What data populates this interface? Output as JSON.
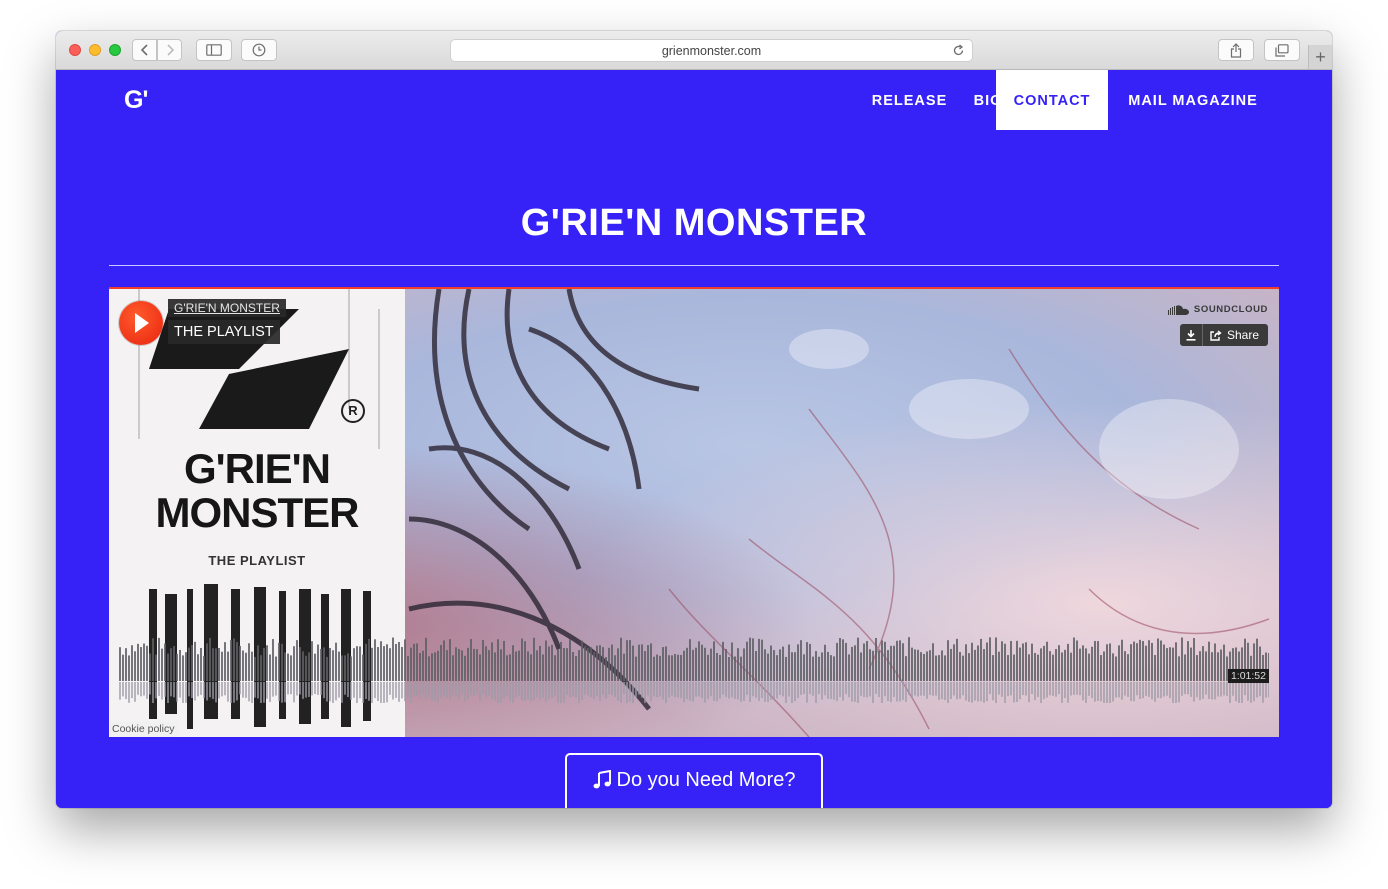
{
  "browser": {
    "url": "grienmonster.com"
  },
  "site": {
    "logo": "G'",
    "nav": [
      {
        "label": "RELEASE"
      },
      {
        "label": "BIO"
      },
      {
        "label": "CONTACT",
        "active": true
      },
      {
        "label": "MAIL MAGAZINE"
      }
    ],
    "title": "G'RIE'N MONSTER",
    "accent_color": "#3622f7"
  },
  "player": {
    "artist": "G'RIE'N MONSTER",
    "track": "THE PLAYLIST",
    "brand": "SOUNDCLOUD",
    "share_label": "Share",
    "duration": "1:01:52",
    "cookie_label": "Cookie policy",
    "cover_text": {
      "reg_mark": "R",
      "title_line1": "G'RIE'N",
      "title_line2": "MONSTER",
      "subtitle": "THE PLAYLIST"
    },
    "play_color": "#f23d2b"
  },
  "cta": {
    "label": "Do you Need More?",
    "icon": "music-note-icon"
  }
}
